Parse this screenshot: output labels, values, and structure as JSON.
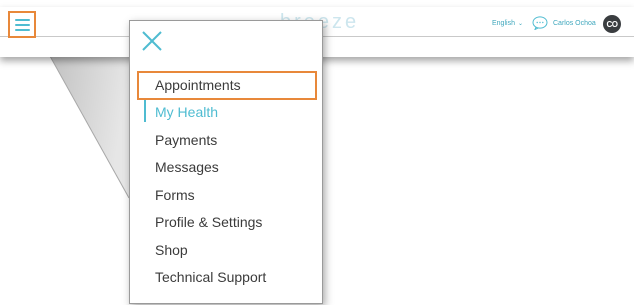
{
  "header": {
    "brand": "breeze",
    "language": "English",
    "user_name": "Carlos Ochoa",
    "avatar_initials": "CO"
  },
  "menu": {
    "items": [
      {
        "label": "Appointments",
        "state": "highlighted"
      },
      {
        "label": "My Health",
        "state": "active"
      },
      {
        "label": "Payments",
        "state": "normal"
      },
      {
        "label": "Messages",
        "state": "normal"
      },
      {
        "label": "Forms",
        "state": "normal"
      },
      {
        "label": "Profile & Settings",
        "state": "normal"
      },
      {
        "label": "Shop",
        "state": "normal"
      },
      {
        "label": "Technical Support",
        "state": "normal"
      }
    ]
  },
  "colors": {
    "accent": "#4fbcd1",
    "highlight": "#e8883a",
    "text": "#3b3b3b",
    "avatar_bg": "#3a3d40"
  },
  "icons": [
    "hamburger-icon",
    "close-icon",
    "chat-icon",
    "chevron-down-icon"
  ]
}
